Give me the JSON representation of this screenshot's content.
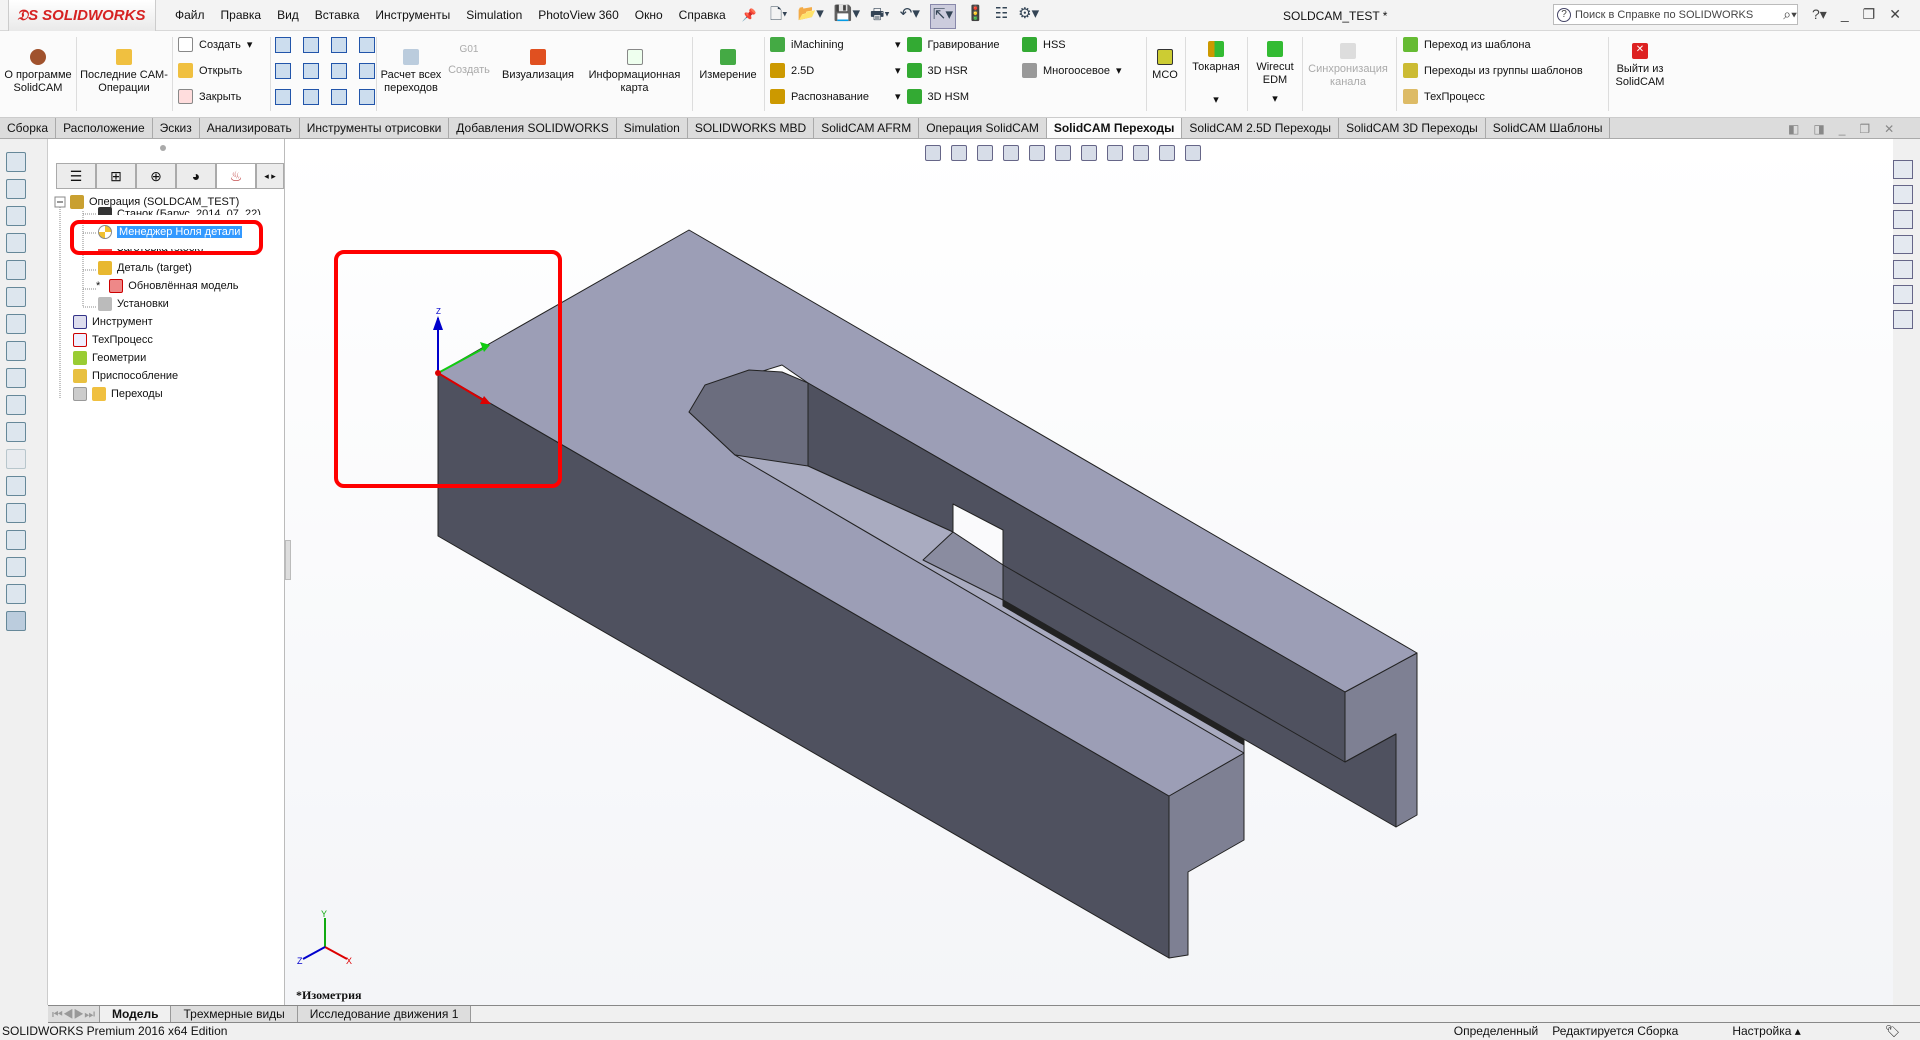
{
  "app": {
    "logo": "SOLIDWORKS",
    "title": "SOLDCAM_TEST *",
    "search_placeholder": "Поиск в Справке по SOLIDWORKS"
  },
  "menu": [
    "Файл",
    "Правка",
    "Вид",
    "Вставка",
    "Инструменты",
    "Simulation",
    "PhotoView 360",
    "Окно",
    "Справка"
  ],
  "ribbon": {
    "about": "О программе SolidCAM",
    "recent": "Последние CAM-Операции",
    "file_ops": [
      "Создать",
      "Открыть",
      "Закрыть"
    ],
    "calc": "Расчет всех переходов",
    "g01": "G01",
    "create": "Создать",
    "visual": "Визуализация",
    "infocard": "Информационная карта",
    "measure": "Измерение",
    "col1": [
      "iMachining",
      "2.5D",
      "Распознавание"
    ],
    "col2": [
      "Гравирование",
      "3D HSR",
      "3D HSM"
    ],
    "col3": [
      "HSS",
      "Многоосевое"
    ],
    "mco": "MCO",
    "turning": "Токарная",
    "wirecut": "Wirecut EDM",
    "sync": "Синхронизация канала",
    "templates": [
      "Переход из шаблона",
      "Переходы из группы шаблонов",
      "ТехПроцесс"
    ],
    "exit": "Выйти из SolidCAM"
  },
  "tabs": [
    "Сборка",
    "Расположение",
    "Эскиз",
    "Анализировать",
    "Инструменты отрисовки",
    "Добавления SOLIDWORKS",
    "Simulation",
    "SOLIDWORKS MBD",
    "SolidCAM AFRM",
    "Операция  SolidCAM",
    "SolidCAM Переходы",
    "SolidCAM 2.5D Переходы",
    "SolidCAM 3D Переходы",
    "SolidCAM Шаблоны"
  ],
  "active_tab": "SolidCAM Переходы",
  "tree": {
    "root": "Операция (SOLDCAM_TEST)",
    "machine": "Станок (Барус_2014_07_22)",
    "selected": "Менеджер Ноля детали",
    "stock": "Заготовка (stock)",
    "target": "Деталь (target)",
    "updated_marker": "*",
    "updated": "Обновлённая модель",
    "settings": "Установки",
    "tool": "Инструмент",
    "process": "ТехПроцесс",
    "geometry": "Геометрии",
    "fixture": "Приспособление",
    "operations": "Переходы"
  },
  "viewport": {
    "view_name": "*Изометрия",
    "axis_labels": [
      "Z",
      "X",
      "Y"
    ]
  },
  "bottom_tabs": [
    "Модель",
    "Трехмерные виды",
    "Исследование движения 1"
  ],
  "status": {
    "edition": "SOLIDWORKS Premium 2016 x64 Edition",
    "state": "Определенный",
    "editing": "Редактируется Сборка",
    "settings": "Настройка"
  },
  "colors": {
    "highlight": "#ff0000",
    "selection": "#3399ff",
    "part_top": "#9c9eb6",
    "part_side": "#4f515f",
    "part_front": "#7e8093"
  }
}
